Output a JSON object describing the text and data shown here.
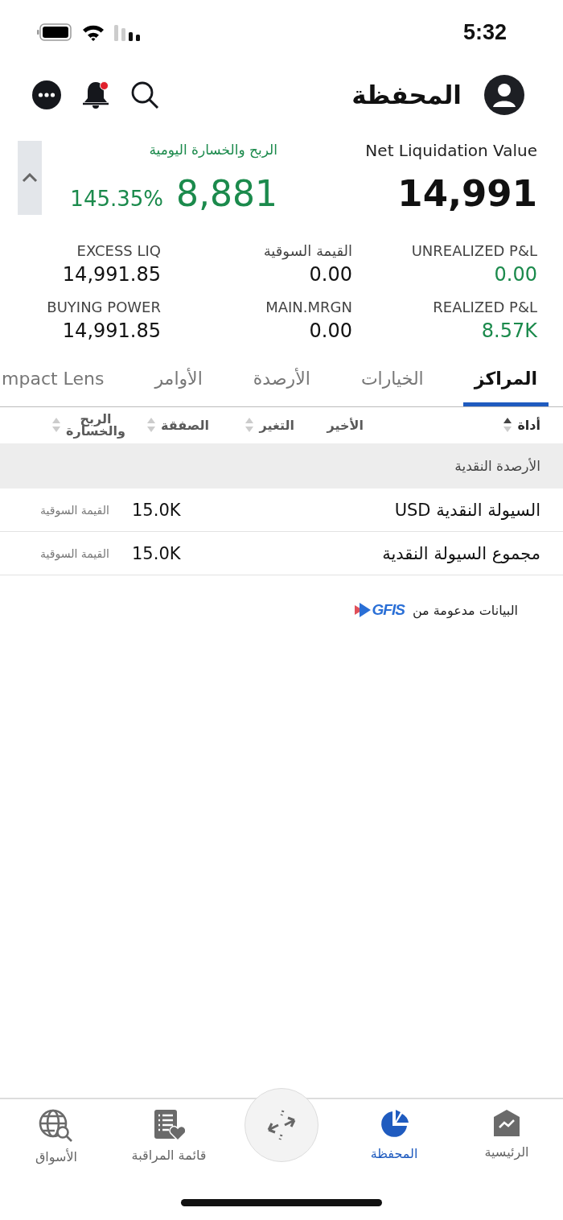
{
  "status_bar": {
    "time": "5:32"
  },
  "header": {
    "title": "المحفظة",
    "notification_dot": true
  },
  "summary": {
    "net_liquidation": {
      "label": "Net Liquidation Value",
      "value": "14,991"
    },
    "daily_pnl": {
      "label": "الربح والخسارة اليومية",
      "value": "8,881",
      "percent": "145.35%"
    }
  },
  "metrics": [
    {
      "label": "UNREALIZED P&L",
      "value": "0.00",
      "gain": true
    },
    {
      "label": "القيمة السوقية",
      "value": "0.00",
      "gain": false
    },
    {
      "label": "EXCESS LIQ",
      "value": "14,991.85",
      "gain": false
    },
    {
      "label": "REALIZED P&L",
      "value": "8.57K",
      "gain": true
    },
    {
      "label": "MAIN.MRGN",
      "value": "0.00",
      "gain": false
    },
    {
      "label": "BUYING POWER",
      "value": "14,991.85",
      "gain": false
    }
  ],
  "tabs": [
    {
      "label": "المراكز",
      "selected": true
    },
    {
      "label": "الخيارات",
      "selected": false
    },
    {
      "label": "الأرصدة",
      "selected": false
    },
    {
      "label": "الأوامر",
      "selected": false
    },
    {
      "label": "mpact Lens",
      "selected": false
    }
  ],
  "table": {
    "columns": [
      {
        "label": "أداة",
        "sortable": true,
        "sorted": true
      },
      {
        "label": "الأخير",
        "sortable": false,
        "sorted": false
      },
      {
        "label": "التغير",
        "sortable": true,
        "sorted": false
      },
      {
        "label": "الصفقة",
        "sortable": true,
        "sorted": false
      },
      {
        "label": "الربح والخسارة",
        "sortable": true,
        "sorted": false
      }
    ],
    "sections": [
      {
        "title": "الأرصدة النقدية",
        "rows": [
          {
            "name": "السيولة النقدية USD",
            "value": "15.0K",
            "value_label": "القيمة السوقية"
          },
          {
            "name": "مجموع السيولة النقدية",
            "value": "15.0K",
            "value_label": "القيمة السوقية"
          }
        ]
      }
    ]
  },
  "footer_note": {
    "text": "البيانات مدعومة من",
    "logo": "GFIS"
  },
  "nav": {
    "items": [
      {
        "kind": "home",
        "label": "الرئيسية",
        "selected": false
      },
      {
        "kind": "portfolio",
        "label": "المحفظة",
        "selected": true
      },
      {
        "kind": "trade"
      },
      {
        "kind": "watchlist",
        "label": "قائمة المراقبة",
        "selected": false
      },
      {
        "kind": "markets",
        "label": "الأسواق",
        "selected": false
      }
    ]
  }
}
